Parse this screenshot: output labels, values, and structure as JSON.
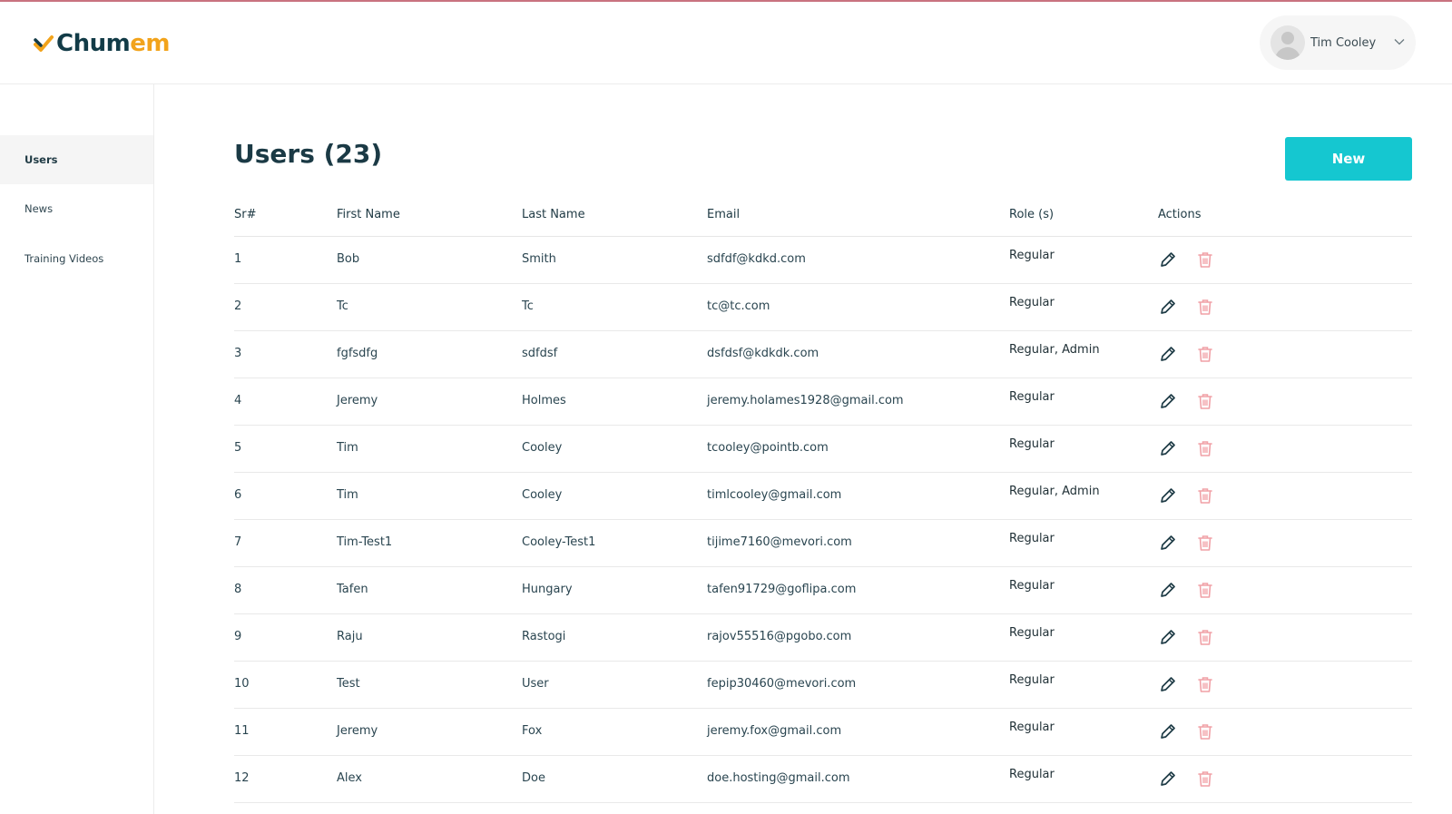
{
  "brand": {
    "name_main": "Chum",
    "name_accent": "em"
  },
  "user": {
    "name": "Tim Cooley"
  },
  "sidebar": {
    "items": [
      {
        "label": "Users",
        "active": true
      },
      {
        "label": "News",
        "active": false
      },
      {
        "label": "Training Videos",
        "active": false
      }
    ]
  },
  "page": {
    "title": "Users (23)",
    "new_label": "New"
  },
  "colors": {
    "accent": "#15c7d0",
    "brand_orange": "#f2a31b",
    "delete_icon": "#f0a0a6"
  },
  "icons": {
    "edit": "pencil-icon",
    "delete": "trash-icon"
  },
  "table": {
    "headers": [
      "Sr#",
      "First Name",
      "Last Name",
      "Email",
      "Role (s)",
      "Actions"
    ],
    "rows": [
      {
        "sr": "1",
        "first": "Bob",
        "last": "Smith",
        "email": "sdfdf@kdkd.com",
        "role": "Regular"
      },
      {
        "sr": "2",
        "first": "Tc",
        "last": "Tc",
        "email": "tc@tc.com",
        "role": "Regular"
      },
      {
        "sr": "3",
        "first": "fgfsdfg",
        "last": "sdfdsf",
        "email": "dsfdsf@kdkdk.com",
        "role": "Regular, Admin"
      },
      {
        "sr": "4",
        "first": "Jeremy",
        "last": "Holmes",
        "email": "jeremy.holames1928@gmail.com",
        "role": "Regular"
      },
      {
        "sr": "5",
        "first": "Tim",
        "last": "Cooley",
        "email": "tcooley@pointb.com",
        "role": "Regular"
      },
      {
        "sr": "6",
        "first": "Tim",
        "last": "Cooley",
        "email": "timlcooley@gmail.com",
        "role": "Regular, Admin"
      },
      {
        "sr": "7",
        "first": "Tim-Test1",
        "last": "Cooley-Test1",
        "email": "tijime7160@mevori.com",
        "role": "Regular"
      },
      {
        "sr": "8",
        "first": "Tafen",
        "last": "Hungary",
        "email": "tafen91729@goflipa.com",
        "role": "Regular"
      },
      {
        "sr": "9",
        "first": "Raju",
        "last": "Rastogi",
        "email": "rajov55516@pgobo.com",
        "role": "Regular"
      },
      {
        "sr": "10",
        "first": "Test",
        "last": "User",
        "email": "fepip30460@mevori.com",
        "role": "Regular"
      },
      {
        "sr": "11",
        "first": "Jeremy",
        "last": "Fox",
        "email": "jeremy.fox@gmail.com",
        "role": "Regular"
      },
      {
        "sr": "12",
        "first": "Alex",
        "last": "Doe",
        "email": "doe.hosting@gmail.com",
        "role": "Regular"
      }
    ]
  }
}
